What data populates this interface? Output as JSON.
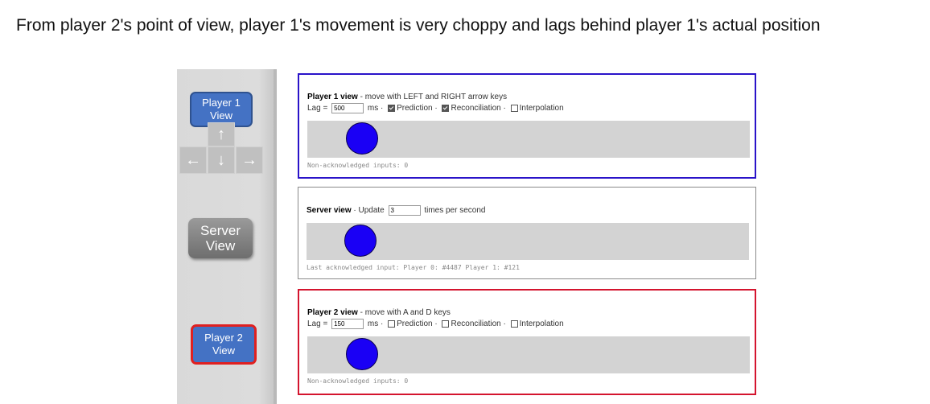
{
  "caption": "From player 2's point of view, player 1's movement is very choppy and lags behind player 1's actual position",
  "left_panel": {
    "player1_button": "Player 1\nView",
    "server_button": "Server\nView",
    "player2_button": "Player 2\nView",
    "arrow_keys": {
      "up": "↑",
      "left": "←",
      "down": "↓",
      "right": "→"
    }
  },
  "player1_view": {
    "title": "Player 1 view",
    "subtitle": " - move with LEFT and RIGHT arrow keys",
    "lag_label": "Lag =",
    "lag_value": "500",
    "lag_unit": "ms ·",
    "prediction": {
      "label": "Prediction",
      "checked": true
    },
    "reconciliation": {
      "label": "Reconciliation",
      "checked": true
    },
    "interpolation": {
      "label": "Interpolation",
      "checked": false
    },
    "status": "Non-acknowledged inputs: 0"
  },
  "server_view": {
    "title": "Server view",
    "subtitle": " · Update",
    "update_value": "3",
    "update_unit": "times per second",
    "status": "Last acknowledged input: Player 0: #4487 Player 1: #121"
  },
  "player2_view": {
    "title": "Player 2 view",
    "subtitle": " - move with A and D keys",
    "lag_label": "Lag =",
    "lag_value": "150",
    "lag_unit": "ms ·",
    "prediction": {
      "label": "Prediction",
      "checked": false
    },
    "reconciliation": {
      "label": "Reconciliation",
      "checked": false
    },
    "interpolation": {
      "label": "Interpolation",
      "checked": false
    },
    "status": "Non-acknowledged inputs: 0"
  },
  "colors": {
    "player1_border": "#2a13c9",
    "player2_border": "#d4142e",
    "ball": "#1a00f5",
    "button_blue": "#4472c4"
  }
}
